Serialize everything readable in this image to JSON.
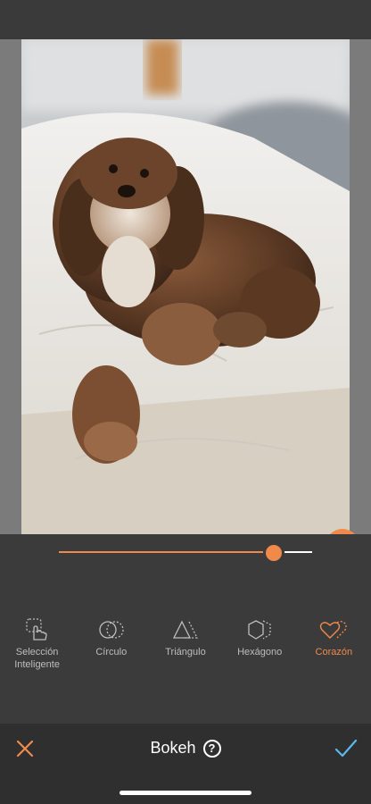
{
  "editor": {
    "slider_value_percent": 85,
    "accent_color": "#ef8a4b"
  },
  "tools": [
    {
      "label_line1": "Selección",
      "label_line2": "Inteligente",
      "icon": "smart-selection-icon",
      "active": false
    },
    {
      "label_line1": "Círculo",
      "label_line2": "",
      "icon": "circle-icon",
      "active": false
    },
    {
      "label_line1": "Triángulo",
      "label_line2": "",
      "icon": "triangle-icon",
      "active": false
    },
    {
      "label_line1": "Hexágono",
      "label_line2": "",
      "icon": "hexagon-icon",
      "active": false
    },
    {
      "label_line1": "Corazón",
      "label_line2": "",
      "icon": "heart-icon",
      "active": true
    }
  ],
  "bottom_bar": {
    "title": "Bokeh",
    "help_label": "?"
  }
}
